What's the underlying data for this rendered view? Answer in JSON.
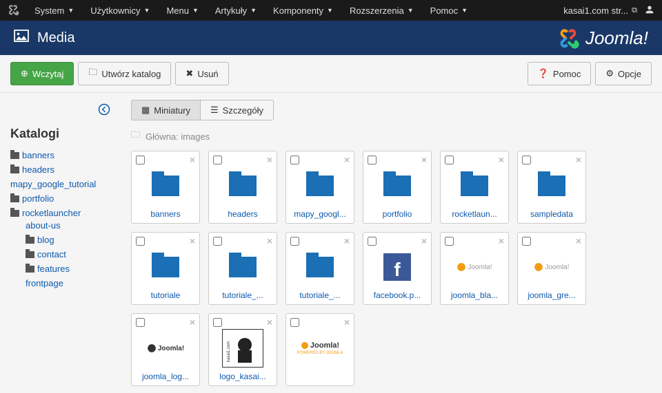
{
  "topbar": {
    "menu": [
      "System",
      "Użytkownicy",
      "Menu",
      "Artykuły",
      "Komponenty",
      "Rozszerzenia",
      "Pomoc"
    ],
    "site": "kasai1.com str..."
  },
  "header": {
    "title": "Media",
    "brand": "Joomla!"
  },
  "toolbar": {
    "upload": "Wczytaj",
    "create": "Utwórz katalog",
    "delete": "Usuń",
    "help": "Pomoc",
    "options": "Opcje"
  },
  "sidebar": {
    "title": "Katalogi",
    "tree": [
      {
        "label": "banners"
      },
      {
        "label": "headers"
      },
      {
        "label": "mapy_google_tutorial",
        "nofolder": true
      },
      {
        "label": "portfolio"
      },
      {
        "label": "rocketlauncher",
        "children": [
          {
            "label": "about-us",
            "nofolder": true
          },
          {
            "label": "blog"
          },
          {
            "label": "contact"
          },
          {
            "label": "features"
          },
          {
            "label": "frontpage",
            "nofolder": true
          }
        ]
      }
    ]
  },
  "main": {
    "tabs": {
      "thumb": "Miniatury",
      "detail": "Szczegóły"
    },
    "breadcrumb_prefix": "Główna:",
    "breadcrumb_path": "images",
    "items": [
      {
        "type": "folder",
        "label": "banners"
      },
      {
        "type": "folder",
        "label": "headers"
      },
      {
        "type": "folder",
        "label": "mapy_googl..."
      },
      {
        "type": "folder",
        "label": "portfolio"
      },
      {
        "type": "folder",
        "label": "rocketlaun..."
      },
      {
        "type": "folder",
        "label": "sampledata"
      },
      {
        "type": "folder",
        "label": "tutoriale"
      },
      {
        "type": "folder",
        "label": "tutoriale_..."
      },
      {
        "type": "folder",
        "label": "tutoriale_..."
      },
      {
        "type": "image",
        "label": "facebook.p...",
        "thumb": "fb"
      },
      {
        "type": "image",
        "label": "joomla_bla...",
        "thumb": "jlogo"
      },
      {
        "type": "image",
        "label": "joomla_gre...",
        "thumb": "jlogo"
      },
      {
        "type": "image",
        "label": "joomla_log...",
        "thumb": "jlogo-dark"
      },
      {
        "type": "image",
        "label": "logo_kasai...",
        "thumb": "kasai"
      },
      {
        "type": "image",
        "label": "",
        "thumb": "jpowered"
      }
    ]
  }
}
